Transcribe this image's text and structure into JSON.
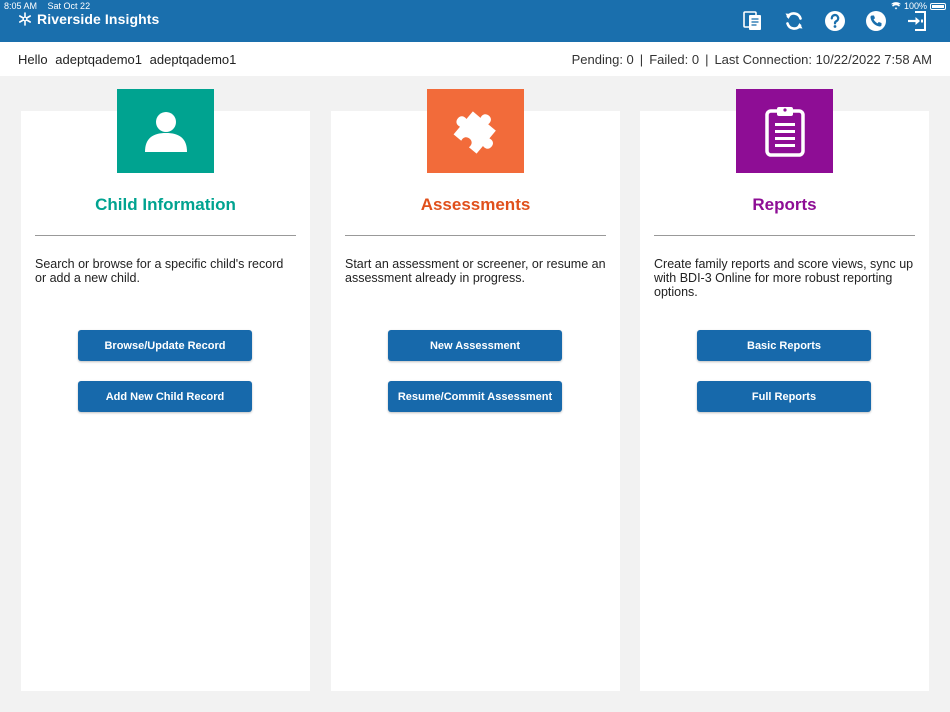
{
  "status_bar": {
    "time": "8:05 AM",
    "date": "Sat Oct 22",
    "battery": "100%"
  },
  "brand": {
    "name": "Riverside Insights"
  },
  "toolbar": {
    "icons": [
      "documents-icon",
      "sync-icon",
      "help-icon",
      "phone-icon",
      "logout-icon"
    ]
  },
  "greeting": {
    "hello": "Hello",
    "first_name": "adeptqademo1",
    "last_name": "adeptqademo1"
  },
  "sync": {
    "pending": "Pending: 0",
    "failed": "Failed: 0",
    "last_connection": "Last Connection: 10/22/2022 7:58 AM",
    "separator": "|"
  },
  "cards": [
    {
      "title": "Child Information",
      "description": "Search or browse for a specific child's record or add a new child.",
      "buttons": [
        "Browse/Update Record",
        "Add New Child Record"
      ],
      "color": "#00a390",
      "title_color": "#00a390",
      "icon": "person-icon"
    },
    {
      "title": "Assessments",
      "description": "Start an assessment or screener, or resume an assessment already in progress.",
      "buttons": [
        "New Assessment",
        "Resume/Commit Assessment"
      ],
      "color": "#f26b3a",
      "title_color": "#e0501c",
      "icon": "puzzle-icon"
    },
    {
      "title": "Reports",
      "description": "Create family reports and score views, sync up with BDI-3 Online for more robust reporting options.",
      "buttons": [
        "Basic Reports",
        "Full Reports"
      ],
      "color": "#8e0d95",
      "title_color": "#8e0d95",
      "icon": "clipboard-icon"
    }
  ],
  "colors": {
    "appbar": "#1a6fad",
    "button": "#1769ab",
    "background": "#f2f2f2"
  }
}
